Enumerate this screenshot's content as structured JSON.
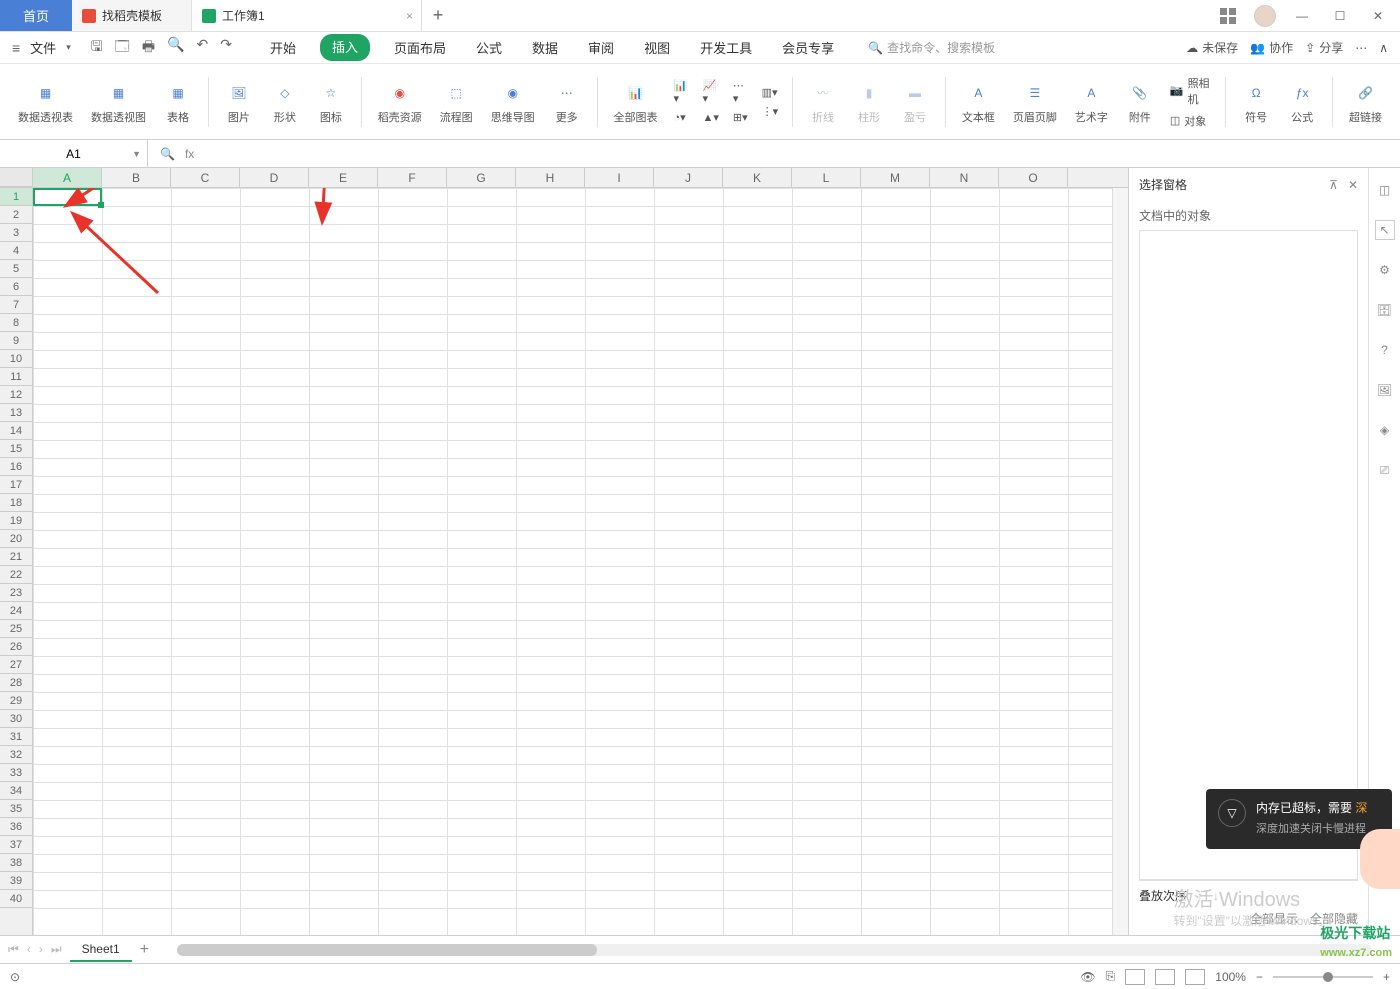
{
  "titlebar": {
    "home": "首页",
    "template_tab": "找稻壳模板",
    "doc_tab": "工作簿1"
  },
  "menubar": {
    "file": "文件",
    "tabs": [
      "开始",
      "插入",
      "页面布局",
      "公式",
      "数据",
      "审阅",
      "视图",
      "开发工具",
      "会员专享"
    ],
    "active_tab": "插入",
    "search_cmd": "查找命令、搜索模板",
    "unsaved": "未保存",
    "coop": "协作",
    "share": "分享"
  },
  "ribbon": {
    "items": [
      "数据透视表",
      "数据透视图",
      "表格",
      "图片",
      "形状",
      "图标",
      "稻壳资源",
      "流程图",
      "思维导图",
      "更多",
      "全部图表",
      "折线",
      "柱形",
      "盈亏",
      "文本框",
      "页眉页脚",
      "艺术字",
      "附件",
      "对象",
      "符号",
      "公式",
      "超链接"
    ],
    "camera": "照相机"
  },
  "formula": {
    "cell_ref": "A1",
    "fx": "fx"
  },
  "columns": [
    "A",
    "B",
    "C",
    "D",
    "E",
    "F",
    "G",
    "H",
    "I",
    "J",
    "K",
    "L",
    "M",
    "N",
    "O"
  ],
  "rows_count": 40,
  "sidepanel": {
    "title": "选择窗格",
    "subtitle": "文档中的对象",
    "stack_order": "叠放次序",
    "show_all": "全部显示",
    "hide_all": "全部隐藏"
  },
  "sheettabs": {
    "sheet": "Sheet1"
  },
  "statusbar": {
    "zoom": "100%"
  },
  "notification": {
    "title": "内存已超标，需要",
    "action": "深",
    "subtitle": "深度加速关闭卡慢进程"
  },
  "watermark": {
    "title": "激活 Windows",
    "subtitle": "转到\"设置\"以激活 Windows。"
  },
  "logo": "极光下载站",
  "logo_url": "www.xz7.com"
}
